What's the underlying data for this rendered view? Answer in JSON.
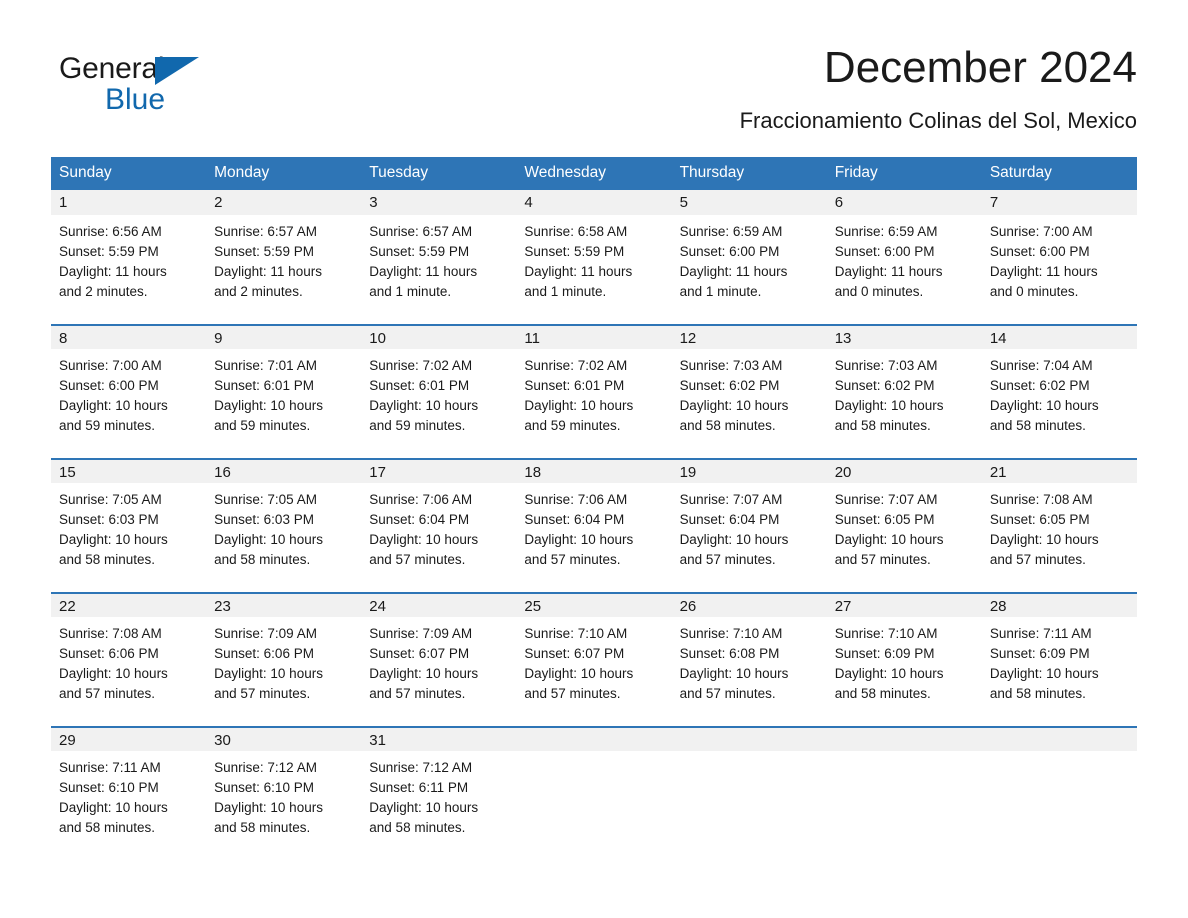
{
  "logo": {
    "word_general": "General",
    "word_blue": "Blue",
    "triangle": "triangle-icon"
  },
  "header": {
    "title": "December 2024",
    "subtitle": "Fraccionamiento Colinas del Sol, Mexico"
  },
  "calendar": {
    "weekday_headers": [
      "Sunday",
      "Monday",
      "Tuesday",
      "Wednesday",
      "Thursday",
      "Friday",
      "Saturday"
    ],
    "accent_color": "#2e75b6",
    "band_color": "#f1f1f1",
    "weeks": [
      [
        {
          "day": "1",
          "sunrise": "Sunrise: 6:56 AM",
          "sunset": "Sunset: 5:59 PM",
          "daylight_line1": "Daylight: 11 hours",
          "daylight_line2": "and 2 minutes."
        },
        {
          "day": "2",
          "sunrise": "Sunrise: 6:57 AM",
          "sunset": "Sunset: 5:59 PM",
          "daylight_line1": "Daylight: 11 hours",
          "daylight_line2": "and 2 minutes."
        },
        {
          "day": "3",
          "sunrise": "Sunrise: 6:57 AM",
          "sunset": "Sunset: 5:59 PM",
          "daylight_line1": "Daylight: 11 hours",
          "daylight_line2": "and 1 minute."
        },
        {
          "day": "4",
          "sunrise": "Sunrise: 6:58 AM",
          "sunset": "Sunset: 5:59 PM",
          "daylight_line1": "Daylight: 11 hours",
          "daylight_line2": "and 1 minute."
        },
        {
          "day": "5",
          "sunrise": "Sunrise: 6:59 AM",
          "sunset": "Sunset: 6:00 PM",
          "daylight_line1": "Daylight: 11 hours",
          "daylight_line2": "and 1 minute."
        },
        {
          "day": "6",
          "sunrise": "Sunrise: 6:59 AM",
          "sunset": "Sunset: 6:00 PM",
          "daylight_line1": "Daylight: 11 hours",
          "daylight_line2": "and 0 minutes."
        },
        {
          "day": "7",
          "sunrise": "Sunrise: 7:00 AM",
          "sunset": "Sunset: 6:00 PM",
          "daylight_line1": "Daylight: 11 hours",
          "daylight_line2": "and 0 minutes."
        }
      ],
      [
        {
          "day": "8",
          "sunrise": "Sunrise: 7:00 AM",
          "sunset": "Sunset: 6:00 PM",
          "daylight_line1": "Daylight: 10 hours",
          "daylight_line2": "and 59 minutes."
        },
        {
          "day": "9",
          "sunrise": "Sunrise: 7:01 AM",
          "sunset": "Sunset: 6:01 PM",
          "daylight_line1": "Daylight: 10 hours",
          "daylight_line2": "and 59 minutes."
        },
        {
          "day": "10",
          "sunrise": "Sunrise: 7:02 AM",
          "sunset": "Sunset: 6:01 PM",
          "daylight_line1": "Daylight: 10 hours",
          "daylight_line2": "and 59 minutes."
        },
        {
          "day": "11",
          "sunrise": "Sunrise: 7:02 AM",
          "sunset": "Sunset: 6:01 PM",
          "daylight_line1": "Daylight: 10 hours",
          "daylight_line2": "and 59 minutes."
        },
        {
          "day": "12",
          "sunrise": "Sunrise: 7:03 AM",
          "sunset": "Sunset: 6:02 PM",
          "daylight_line1": "Daylight: 10 hours",
          "daylight_line2": "and 58 minutes."
        },
        {
          "day": "13",
          "sunrise": "Sunrise: 7:03 AM",
          "sunset": "Sunset: 6:02 PM",
          "daylight_line1": "Daylight: 10 hours",
          "daylight_line2": "and 58 minutes."
        },
        {
          "day": "14",
          "sunrise": "Sunrise: 7:04 AM",
          "sunset": "Sunset: 6:02 PM",
          "daylight_line1": "Daylight: 10 hours",
          "daylight_line2": "and 58 minutes."
        }
      ],
      [
        {
          "day": "15",
          "sunrise": "Sunrise: 7:05 AM",
          "sunset": "Sunset: 6:03 PM",
          "daylight_line1": "Daylight: 10 hours",
          "daylight_line2": "and 58 minutes."
        },
        {
          "day": "16",
          "sunrise": "Sunrise: 7:05 AM",
          "sunset": "Sunset: 6:03 PM",
          "daylight_line1": "Daylight: 10 hours",
          "daylight_line2": "and 58 minutes."
        },
        {
          "day": "17",
          "sunrise": "Sunrise: 7:06 AM",
          "sunset": "Sunset: 6:04 PM",
          "daylight_line1": "Daylight: 10 hours",
          "daylight_line2": "and 57 minutes."
        },
        {
          "day": "18",
          "sunrise": "Sunrise: 7:06 AM",
          "sunset": "Sunset: 6:04 PM",
          "daylight_line1": "Daylight: 10 hours",
          "daylight_line2": "and 57 minutes."
        },
        {
          "day": "19",
          "sunrise": "Sunrise: 7:07 AM",
          "sunset": "Sunset: 6:04 PM",
          "daylight_line1": "Daylight: 10 hours",
          "daylight_line2": "and 57 minutes."
        },
        {
          "day": "20",
          "sunrise": "Sunrise: 7:07 AM",
          "sunset": "Sunset: 6:05 PM",
          "daylight_line1": "Daylight: 10 hours",
          "daylight_line2": "and 57 minutes."
        },
        {
          "day": "21",
          "sunrise": "Sunrise: 7:08 AM",
          "sunset": "Sunset: 6:05 PM",
          "daylight_line1": "Daylight: 10 hours",
          "daylight_line2": "and 57 minutes."
        }
      ],
      [
        {
          "day": "22",
          "sunrise": "Sunrise: 7:08 AM",
          "sunset": "Sunset: 6:06 PM",
          "daylight_line1": "Daylight: 10 hours",
          "daylight_line2": "and 57 minutes."
        },
        {
          "day": "23",
          "sunrise": "Sunrise: 7:09 AM",
          "sunset": "Sunset: 6:06 PM",
          "daylight_line1": "Daylight: 10 hours",
          "daylight_line2": "and 57 minutes."
        },
        {
          "day": "24",
          "sunrise": "Sunrise: 7:09 AM",
          "sunset": "Sunset: 6:07 PM",
          "daylight_line1": "Daylight: 10 hours",
          "daylight_line2": "and 57 minutes."
        },
        {
          "day": "25",
          "sunrise": "Sunrise: 7:10 AM",
          "sunset": "Sunset: 6:07 PM",
          "daylight_line1": "Daylight: 10 hours",
          "daylight_line2": "and 57 minutes."
        },
        {
          "day": "26",
          "sunrise": "Sunrise: 7:10 AM",
          "sunset": "Sunset: 6:08 PM",
          "daylight_line1": "Daylight: 10 hours",
          "daylight_line2": "and 57 minutes."
        },
        {
          "day": "27",
          "sunrise": "Sunrise: 7:10 AM",
          "sunset": "Sunset: 6:09 PM",
          "daylight_line1": "Daylight: 10 hours",
          "daylight_line2": "and 58 minutes."
        },
        {
          "day": "28",
          "sunrise": "Sunrise: 7:11 AM",
          "sunset": "Sunset: 6:09 PM",
          "daylight_line1": "Daylight: 10 hours",
          "daylight_line2": "and 58 minutes."
        }
      ],
      [
        {
          "day": "29",
          "sunrise": "Sunrise: 7:11 AM",
          "sunset": "Sunset: 6:10 PM",
          "daylight_line1": "Daylight: 10 hours",
          "daylight_line2": "and 58 minutes."
        },
        {
          "day": "30",
          "sunrise": "Sunrise: 7:12 AM",
          "sunset": "Sunset: 6:10 PM",
          "daylight_line1": "Daylight: 10 hours",
          "daylight_line2": "and 58 minutes."
        },
        {
          "day": "31",
          "sunrise": "Sunrise: 7:12 AM",
          "sunset": "Sunset: 6:11 PM",
          "daylight_line1": "Daylight: 10 hours",
          "daylight_line2": "and 58 minutes."
        },
        {
          "day": "",
          "sunrise": "",
          "sunset": "",
          "daylight_line1": "",
          "daylight_line2": ""
        },
        {
          "day": "",
          "sunrise": "",
          "sunset": "",
          "daylight_line1": "",
          "daylight_line2": ""
        },
        {
          "day": "",
          "sunrise": "",
          "sunset": "",
          "daylight_line1": "",
          "daylight_line2": ""
        },
        {
          "day": "",
          "sunrise": "",
          "sunset": "",
          "daylight_line1": "",
          "daylight_line2": ""
        }
      ]
    ]
  }
}
